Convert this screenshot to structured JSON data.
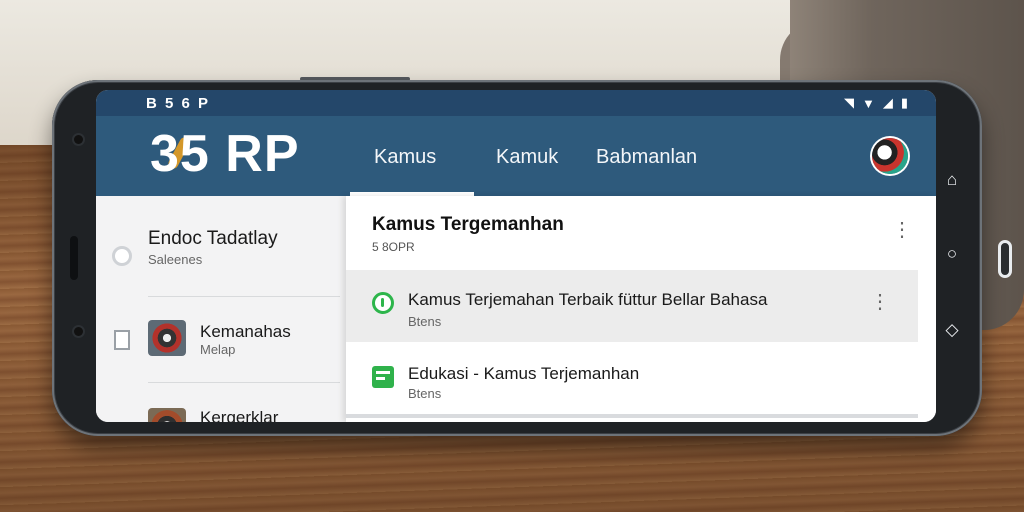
{
  "statusbar": {
    "left_text": "B 5 6 P",
    "icons": [
      "signal-icon",
      "wifi-icon",
      "cell-icon",
      "battery-icon"
    ]
  },
  "appbar": {
    "logo": "35 RP",
    "tabs": [
      {
        "label": "Kamus",
        "active": true
      },
      {
        "label": "Kamuk",
        "active": false
      },
      {
        "label": "Babmanlan",
        "active": false
      }
    ]
  },
  "sidebar": {
    "items": [
      {
        "title": "Endoc Tadatlay",
        "subtitle": "Saleenes"
      },
      {
        "title": "Kemanahas",
        "subtitle": "Melap"
      },
      {
        "title": "Kergerklar",
        "subtitle": ""
      }
    ]
  },
  "main": {
    "header": {
      "title": "Kamus Tergemanhan",
      "subtitle": "5  8OPR"
    },
    "items": [
      {
        "title": "Kamus Terjemahan Terbaik füttur Bellar Bahasa",
        "subtitle": "Btens",
        "selected": true
      },
      {
        "title": "Edukasi  - Kamus Terjemanhan",
        "subtitle": "Btens",
        "selected": false
      }
    ]
  },
  "colors": {
    "statusbar": "#24476a",
    "appbar": "#2e5a7c",
    "accent_green": "#2db54b",
    "logo_accent": "#f0a21c"
  }
}
